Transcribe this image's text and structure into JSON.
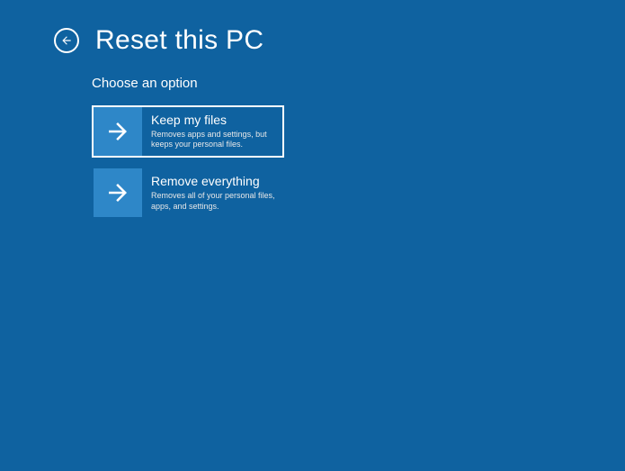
{
  "header": {
    "title": "Reset this PC"
  },
  "content": {
    "subtitle": "Choose an option",
    "options": [
      {
        "title": "Keep my files",
        "desc": "Removes apps and settings, but keeps your personal files."
      },
      {
        "title": "Remove everything",
        "desc": "Removes all of your personal files, apps, and settings."
      }
    ]
  }
}
